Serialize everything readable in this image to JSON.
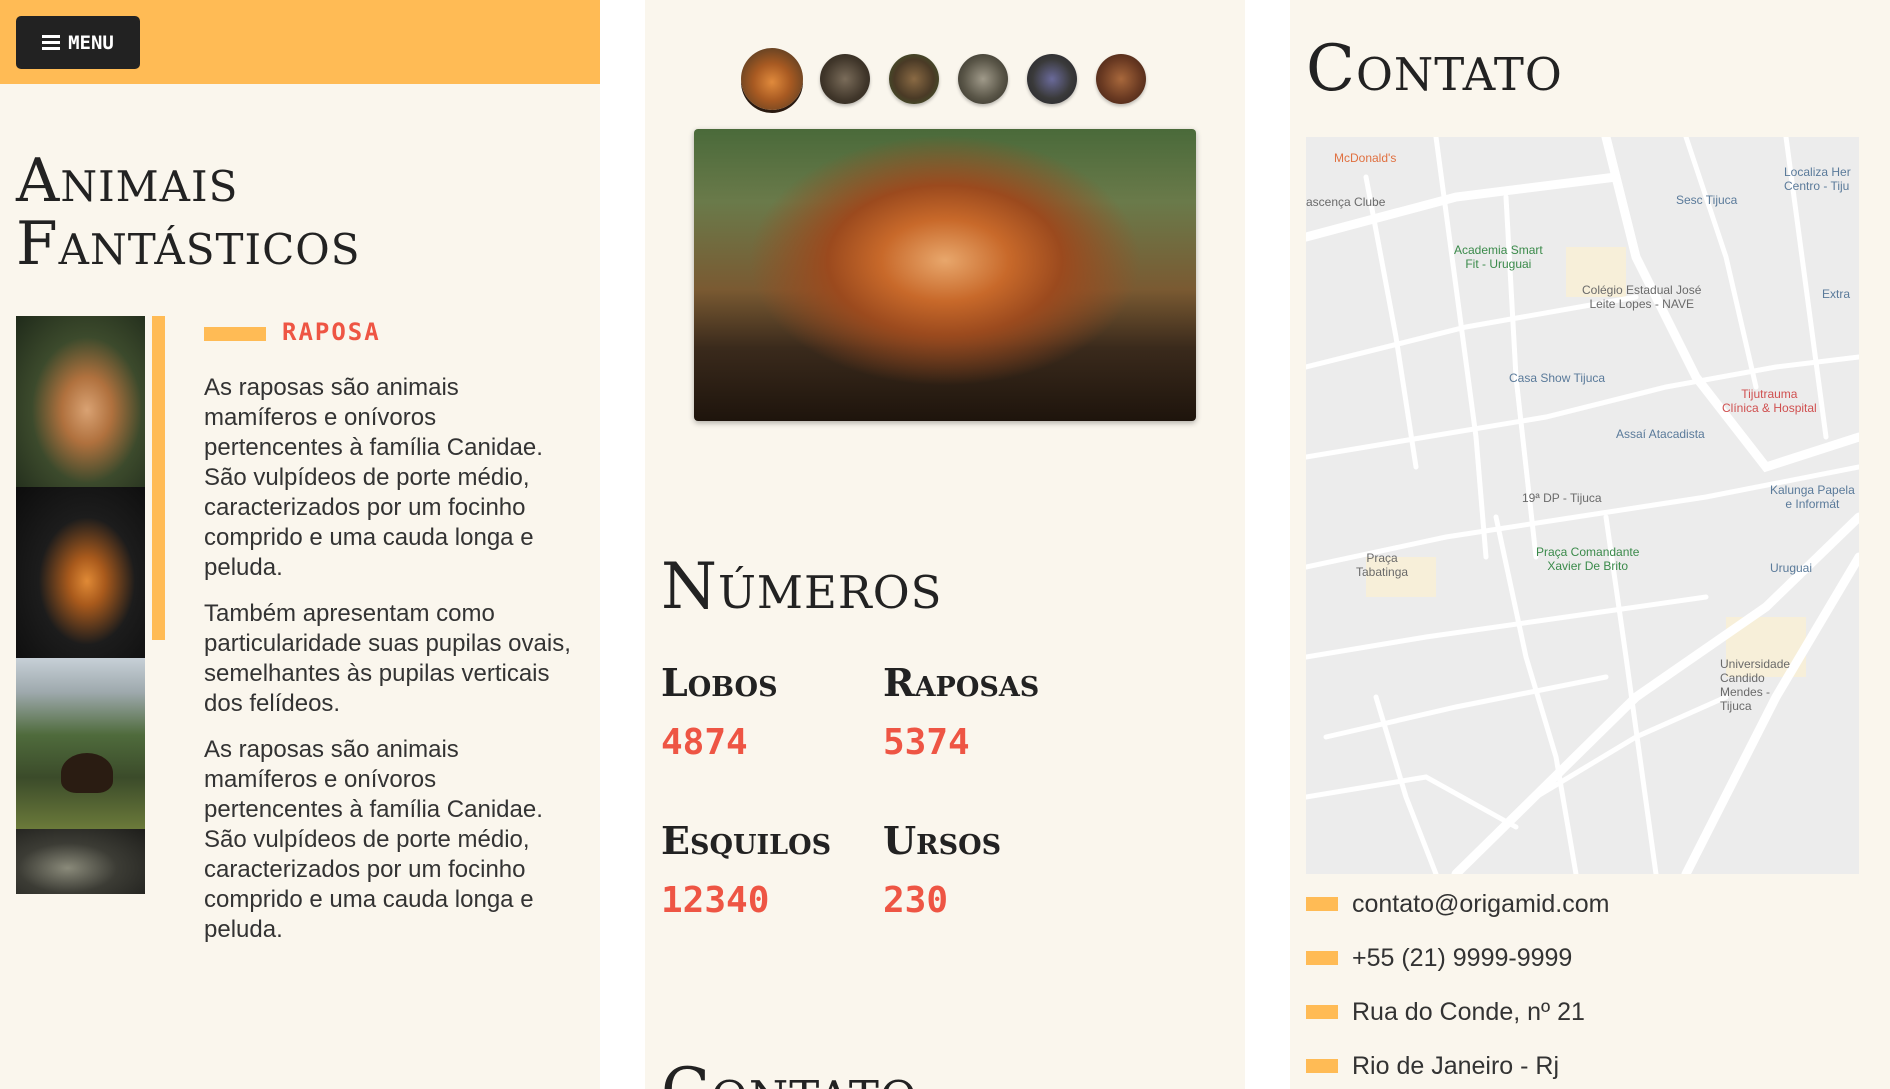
{
  "panel1": {
    "menu_label": "MENU",
    "title_line1": "Animais",
    "title_line2": "Fantásticos",
    "selected_animal": "RAPOSA",
    "paragraphs": [
      "As raposas são animais mamíferos e onívoros pertencentes à família Canidae. São vulpídeos de porte médio, caracterizados por um focinho comprido e uma cauda longa e peluda.",
      "Também apresentam como particularidade suas pupilas ovais, semelhantes às pupilas verticais dos felídeos.",
      "As raposas são animais mamíferos e onívoros pertencentes à família Canidae. São vulpídeos de porte médio, caracterizados por um focinho comprido e uma cauda longa e peluda."
    ],
    "thumbnails": [
      "fox",
      "squirrel",
      "bear",
      "wolf"
    ]
  },
  "panel2": {
    "gallery_thumbnails": [
      "fox",
      "wolf",
      "bear",
      "wolf",
      "monkey",
      "monkey"
    ],
    "numbers_title": "Números",
    "stats": [
      {
        "label": "Lobos",
        "value": "4874"
      },
      {
        "label": "Raposas",
        "value": "5374"
      },
      {
        "label": "Esquilos",
        "value": "12340"
      },
      {
        "label": "Ursos",
        "value": "230"
      }
    ],
    "contato_title": "Contato"
  },
  "panel3": {
    "title": "Contato",
    "map_labels": {
      "mcdonalds": "McDonald's",
      "ascenca": "ascença Clube",
      "academia": "Academia Smart\nFit - Uruguai",
      "colegio": "Colégio Estadual José\nLeite Lopes - NAVE",
      "sesc": "Sesc Tijuca",
      "localiza": "Localiza Her\nCentro - Tiju",
      "extra": "Extra",
      "casa_show": "Casa Show Tijuca",
      "tijutrauma": "Tijutrauma\nClínica & Hospital",
      "assai": "Assaí Atacadista",
      "dp19": "19ª DP - Tijuca",
      "kalunga": "Kalunga Papela\ne Informát",
      "praca_tabatinga": "Praça\nTabatinga",
      "praca_comandante": "Praça Comandante\nXavier De Brito",
      "uruguai": "Uruguai",
      "universidade": "Universidade\nCandido\nMendes -\nTijuca"
    },
    "contacts": [
      "contato@origamid.com",
      "+55 (21) 9999-9999",
      "Rua do Conde, nº 21",
      "Rio de Janeiro - Rj"
    ]
  },
  "colors": {
    "accent": "#ffbb55",
    "highlight": "#ee5544",
    "text": "#222222",
    "background": "#faf6ed"
  }
}
